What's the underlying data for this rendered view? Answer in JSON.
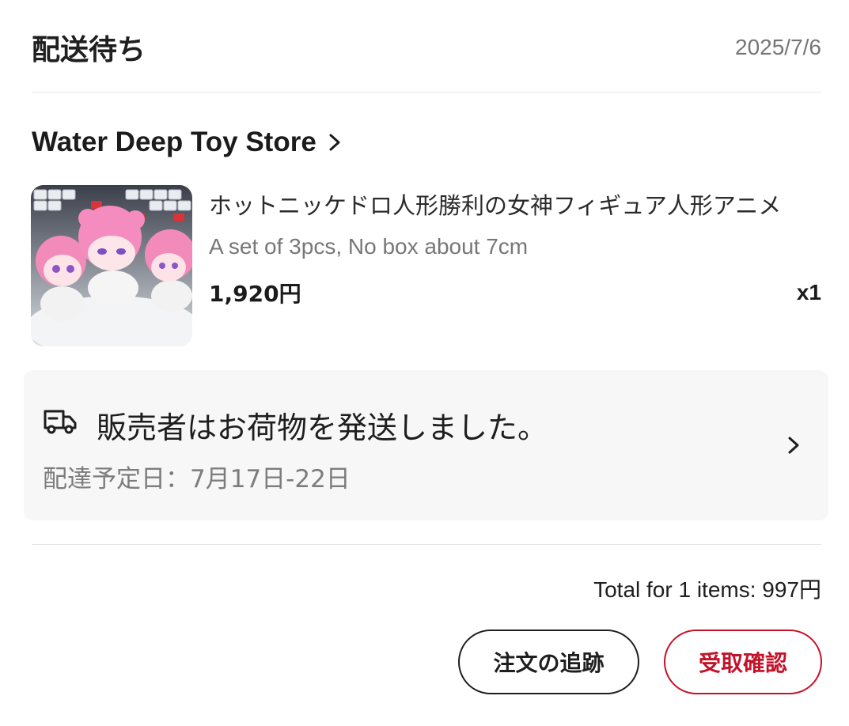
{
  "order": {
    "status": "配送待ち",
    "date": "2025/7/6"
  },
  "store": {
    "name": "Water Deep Toy Store",
    "chevron_icon": "chevron-right-icon"
  },
  "product": {
    "title": "ホットニッケドロ人形勝利の女神フィギュア人形アニメ",
    "variant": "A set of 3pcs, No box about 7cm",
    "price": "1,920円",
    "quantity": "x1"
  },
  "shipping": {
    "icon": "truck-icon",
    "status": "販売者はお荷物を発送しました。",
    "eta": "配達予定日：7月17日-22日"
  },
  "summary": {
    "total": "Total for 1 items: 997円"
  },
  "actions": {
    "track_label": "注文の追跡",
    "confirm_label": "受取確認"
  },
  "colors": {
    "accent": "#c3132a",
    "card_bg": "#f7f7f7",
    "muted_text": "#777777"
  }
}
